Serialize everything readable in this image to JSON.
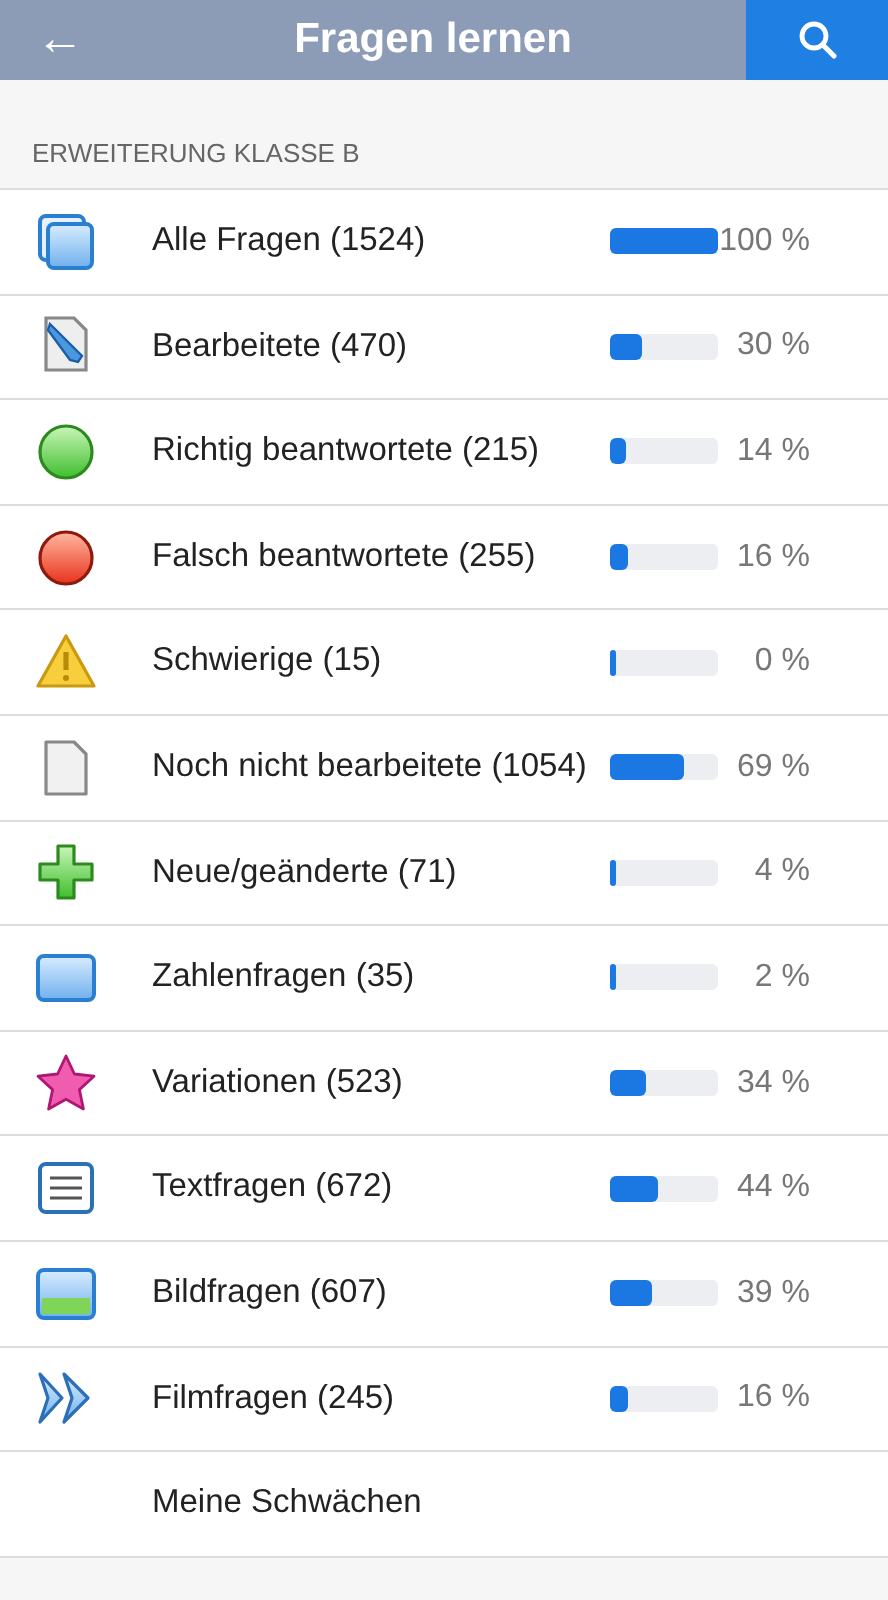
{
  "app_bar": {
    "back": "←",
    "title": "Fragen lernen"
  },
  "section": {
    "heading": "ERWEITERUNG KLASSE B"
  },
  "rows": [
    {
      "kind": "all",
      "label": "Alle Fragen (1524)",
      "level": 1.0,
      "percent": "100 %"
    },
    {
      "kind": "edited",
      "label": "Bearbeitete (470)",
      "level": 0.3,
      "percent": "30 %"
    },
    {
      "kind": "correct",
      "label": "Richtig beantwortete (215)",
      "level": 0.14,
      "percent": "14 %"
    },
    {
      "kind": "wrong",
      "label": "Falsch beantwortete (255)",
      "level": 0.16,
      "percent": "16 %"
    },
    {
      "kind": "difficult",
      "label": "Schwierige (15)",
      "level": 0.0,
      "percent": "0 %"
    },
    {
      "kind": "unedited",
      "label": "Noch nicht bearbeitete (1054)",
      "level": 0.69,
      "percent": "69 %"
    },
    {
      "kind": "new",
      "label": "Neue/geänderte (71)",
      "level": 0.04,
      "percent": "4 %"
    },
    {
      "kind": "number",
      "label": "Zahlenfragen (35)",
      "level": 0.02,
      "percent": "2 %"
    },
    {
      "kind": "variation",
      "label": "Variationen (523)",
      "level": 0.34,
      "percent": "34 %"
    },
    {
      "kind": "text",
      "label": "Textfragen (672)",
      "level": 0.44,
      "percent": "44 %"
    },
    {
      "kind": "image",
      "label": "Bildfragen (607)",
      "level": 0.39,
      "percent": "39 %"
    },
    {
      "kind": "film",
      "label": "Filmfragen (245)",
      "level": 0.16,
      "percent": "16 %"
    },
    {
      "kind": "weakness",
      "label": "Meine Schwächen"
    }
  ]
}
